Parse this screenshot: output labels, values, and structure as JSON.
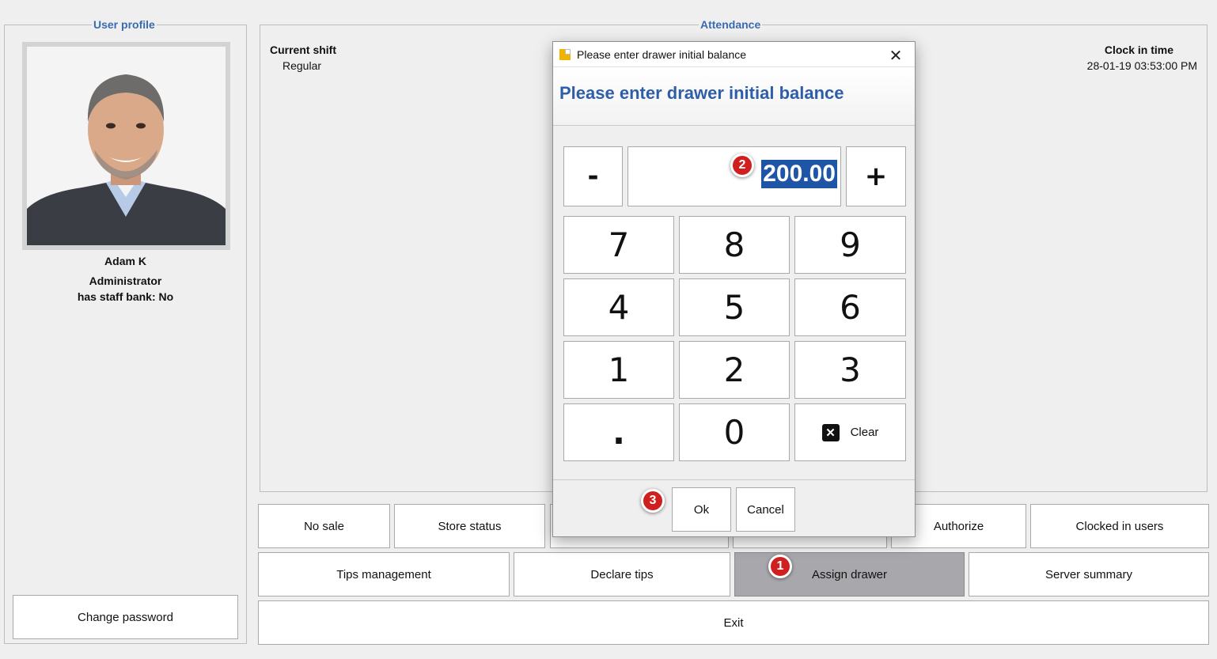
{
  "profile": {
    "legend": "User profile",
    "name": "Adam K",
    "role": "Administrator",
    "staff_bank": "has staff bank: No",
    "change_password": "Change password"
  },
  "attendance": {
    "legend": "Attendance",
    "current_shift_label": "Current shift",
    "current_shift_value": "Regular",
    "clock_in_label": "Clock in time",
    "clock_in_value": "28-01-19 03:53:00 PM"
  },
  "actions": {
    "no_sale": "No sale",
    "store_status": "Store status",
    "authorize": "Authorize",
    "clocked_in_users": "Clocked in users",
    "tips_management": "Tips management",
    "declare_tips": "Declare tips",
    "assign_drawer": "Assign drawer",
    "server_summary": "Server summary",
    "exit": "Exit"
  },
  "dialog": {
    "title": "Please enter drawer initial balance",
    "heading": "Please enter drawer initial balance",
    "minus": "-",
    "plus": "+",
    "amount": "200.00",
    "keys": [
      "7",
      "8",
      "9",
      "4",
      "5",
      "6",
      "1",
      "2",
      "3",
      ".",
      "0"
    ],
    "clear": "Clear",
    "ok": "Ok",
    "cancel": "Cancel"
  },
  "markers": [
    "1",
    "2",
    "3"
  ],
  "colors": {
    "accent": "#2e5ea8",
    "selection": "#1e55a7",
    "marker": "#d01f1f",
    "active_button": "#a8a8ac"
  }
}
